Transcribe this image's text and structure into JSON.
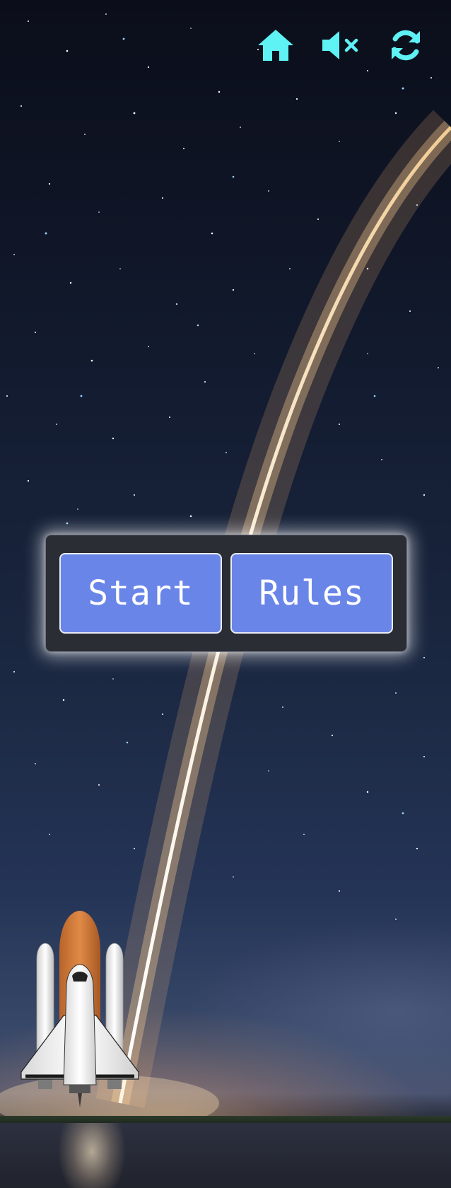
{
  "toolbar": {
    "home_icon": "home-icon",
    "mute_icon": "speaker-muted-icon",
    "restart_icon": "refresh-icon",
    "icon_color": "#5ef2f5"
  },
  "menu": {
    "start_label": "Start",
    "rules_label": "Rules",
    "button_color": "#6a85e8",
    "panel_color": "#2b2d34"
  },
  "scene": {
    "background": "night-sky-rocket-launch",
    "player_sprite": "space-shuttle"
  }
}
